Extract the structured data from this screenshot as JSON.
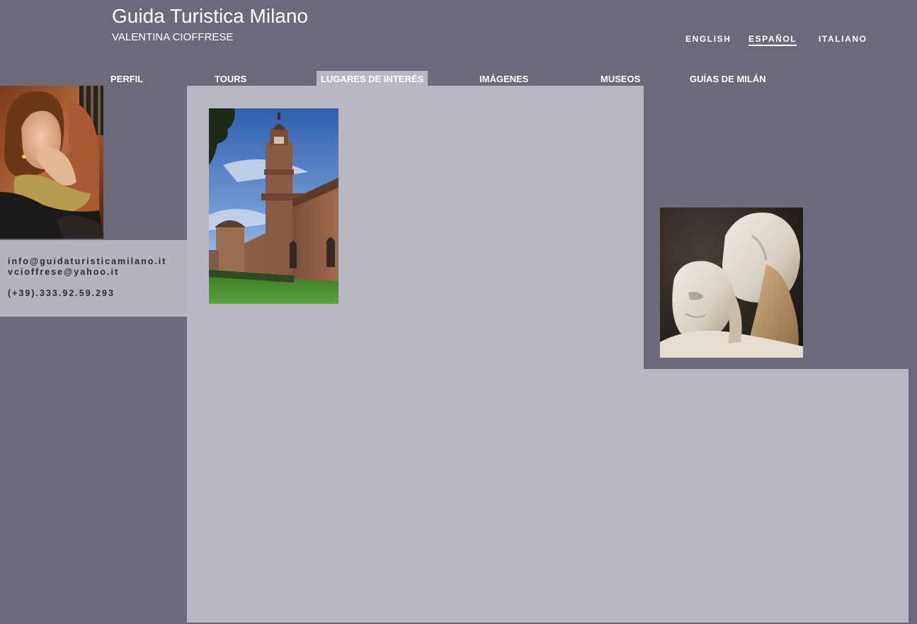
{
  "header": {
    "title": "Guida Turistica Milano",
    "subtitle": "VALENTINA CIOFFRESE"
  },
  "languages": [
    {
      "label": "ENGLISH",
      "active": false
    },
    {
      "label": "ESPAÑOL",
      "active": true
    },
    {
      "label": "ITALIANO",
      "active": false
    }
  ],
  "nav": [
    {
      "label": "PERFIL",
      "active": false
    },
    {
      "label": "TOURS",
      "active": false
    },
    {
      "label": "LUGARES DE INTERÉS",
      "active": true
    },
    {
      "label": "IMÁGENES",
      "active": false
    },
    {
      "label": "MUSEOS",
      "active": false
    },
    {
      "label": "GUÍAS DE MILÁN",
      "active": false
    }
  ],
  "contact": {
    "email_primary": "info@guidaturisticamilano.it",
    "email_secondary": "vcioffrese@yahoo.it",
    "phone": "(+39).333.92.59.293"
  },
  "colors": {
    "background": "#6c6a79",
    "content_panel": "#b9b7c4",
    "contact_box": "#b6b2be",
    "contact_text": "#2e2b38",
    "active_nav": "#b9b7c4"
  },
  "images": {
    "guide_portrait": "guide-portrait-photo",
    "castle": "sforza-castle-photo",
    "sculpture": "marble-sculpture-photo"
  }
}
